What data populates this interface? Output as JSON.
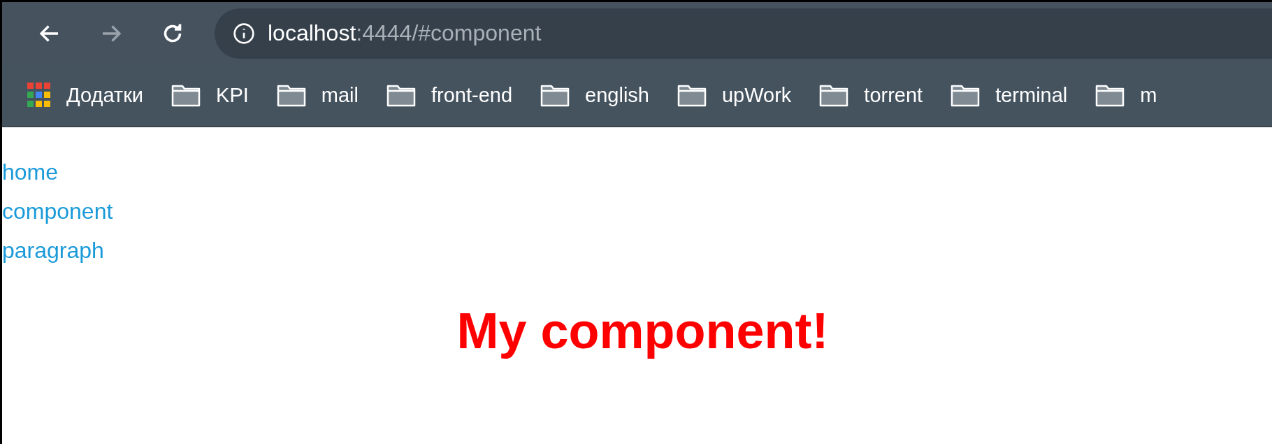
{
  "toolbar": {
    "back": {
      "disabled": false
    },
    "forward": {
      "disabled": true
    },
    "address": {
      "host": "localhost",
      "path": ":4444/#component"
    }
  },
  "bookmarks": [
    {
      "kind": "apps",
      "label": "Додатки"
    },
    {
      "kind": "folder",
      "label": "KPI"
    },
    {
      "kind": "folder",
      "label": "mail"
    },
    {
      "kind": "folder",
      "label": "front-end"
    },
    {
      "kind": "folder",
      "label": "english"
    },
    {
      "kind": "folder",
      "label": "upWork"
    },
    {
      "kind": "folder",
      "label": "torrent"
    },
    {
      "kind": "folder",
      "label": "terminal"
    },
    {
      "kind": "folder",
      "label": "m"
    }
  ],
  "nav_links": [
    "home",
    "component",
    "paragraph"
  ],
  "heading": "My component!"
}
